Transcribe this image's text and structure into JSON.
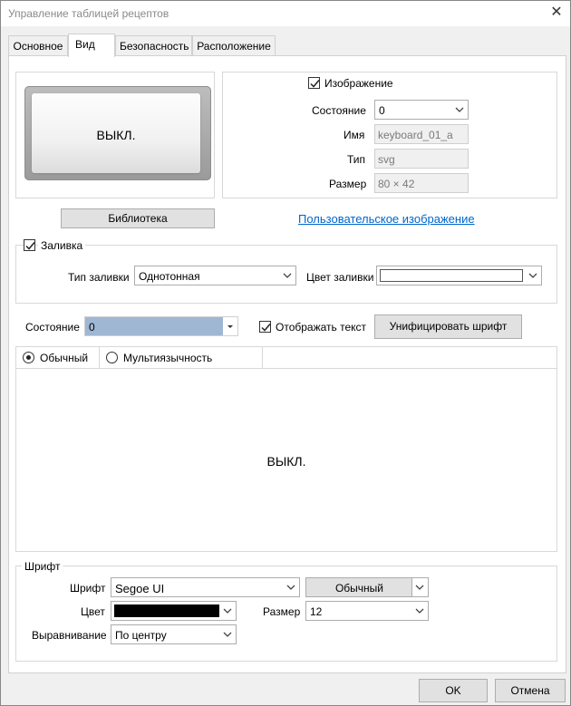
{
  "window": {
    "title": "Управление таблицей рецептов",
    "close": "✕"
  },
  "tabs": [
    {
      "label": "Основное"
    },
    {
      "label": "Вид"
    },
    {
      "label": "Безопасность"
    },
    {
      "label": "Расположение"
    }
  ],
  "image_section": {
    "preview_text": "ВЫКЛ.",
    "image_checkbox_label": "Изображение",
    "image_checked": true,
    "state_label": "Состояние",
    "state_value": "0",
    "name_label": "Имя",
    "name_value": "keyboard_01_a",
    "type_label": "Тип",
    "type_value": "svg",
    "size_label": "Размер",
    "size_value": "80 × 42",
    "library_button": "Библиотека",
    "custom_image_link": "Пользовательское изображение"
  },
  "fill_section": {
    "title": "Заливка",
    "checked": true,
    "fill_type_label": "Тип заливки",
    "fill_type_value": "Однотонная",
    "fill_color_label": "Цвет заливки",
    "fill_color_value": "#ffffff"
  },
  "text_section": {
    "state_label": "Состояние",
    "state_value": "0",
    "show_text_label": "Отображать текст",
    "show_text_checked": true,
    "unify_font_button": "Унифицировать шрифт",
    "mode_normal": "Обычный",
    "mode_multilang": "Мультиязычность",
    "text_preview": "ВЫКЛ."
  },
  "font_section": {
    "title": "Шрифт",
    "font_label": "Шрифт",
    "font_value": "Segoe UI",
    "style_value": "Обычный",
    "color_label": "Цвет",
    "color_value": "#000000",
    "size_label": "Размер",
    "size_value": "12",
    "align_label": "Выравнивание",
    "align_value": "По центру"
  },
  "footer": {
    "ok": "OK",
    "cancel": "Отмена"
  },
  "colors": {
    "selected_combo": "#9fb7d3",
    "link": "#0066cc"
  }
}
